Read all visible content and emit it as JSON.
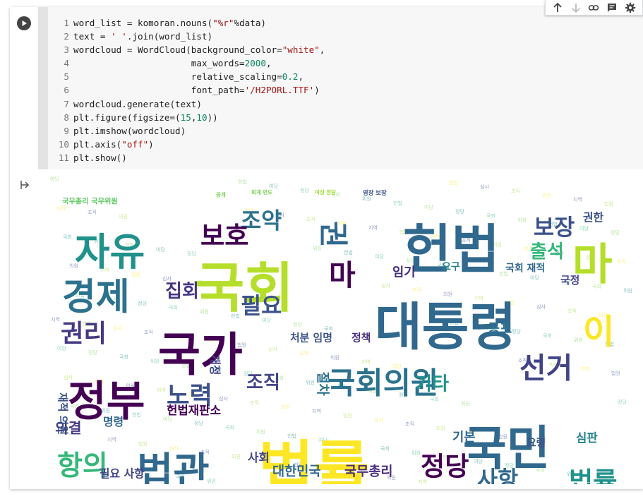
{
  "toolbar": {
    "icons": [
      "arrow-up-icon",
      "arrow-down-icon",
      "link-icon",
      "comment-icon",
      "gear-icon"
    ]
  },
  "code_lines": [
    [
      {
        "t": "word_list = komoran.nouns("
      },
      {
        "t": "\"%r\"",
        "c": "str"
      },
      {
        "t": "%data)"
      }
    ],
    [
      {
        "t": "text = "
      },
      {
        "t": "' '",
        "c": "str"
      },
      {
        "t": ".join(word_list)"
      }
    ],
    [
      {
        "t": "wordcloud = WordCloud(background_color="
      },
      {
        "t": "\"white\"",
        "c": "str"
      },
      {
        "t": ","
      }
    ],
    [
      {
        "t": "                      max_words="
      },
      {
        "t": "2000",
        "c": "num"
      },
      {
        "t": ","
      }
    ],
    [
      {
        "t": "                      relative_scaling="
      },
      {
        "t": "0.2",
        "c": "num"
      },
      {
        "t": ","
      }
    ],
    [
      {
        "t": "                      font_path="
      },
      {
        "t": "'/H2PORL.TTF'",
        "c": "str"
      },
      {
        "t": ")"
      }
    ],
    [
      {
        "t": "wordcloud.generate(text)"
      }
    ],
    [
      {
        "t": "plt.figure(figsize=("
      },
      {
        "t": "15",
        "c": "num"
      },
      {
        "t": ","
      },
      {
        "t": "10",
        "c": "num"
      },
      {
        "t": "))"
      }
    ],
    [
      {
        "t": "plt.imshow(wordcloud)"
      }
    ],
    [
      {
        "t": "plt.axis("
      },
      {
        "t": "\"off\"",
        "c": "str"
      },
      {
        "t": ")"
      }
    ],
    [
      {
        "t": "plt.show()"
      }
    ]
  ],
  "wordcloud": {
    "words": [
      {
        "text": "국무총리 국무위원",
        "size": 11,
        "color": "#5ec962"
      },
      {
        "text": "공개",
        "size": 8,
        "color": "#7ad151"
      },
      {
        "text": "회계 연도",
        "size": 8,
        "color": "#7ad151"
      },
      {
        "text": "여성 정당",
        "size": 8,
        "color": "#a0da39"
      },
      {
        "text": "영장 보장",
        "size": 9,
        "color": "#3b528b"
      },
      {
        "text": "조약",
        "size": 34,
        "color": "#2c728e"
      },
      {
        "text": "보호",
        "size": 40,
        "color": "#440154"
      },
      {
        "text": "자유",
        "size": 58,
        "color": "#21918c"
      },
      {
        "text": "권",
        "size": 44,
        "color": "#31688e"
      },
      {
        "text": "헌법",
        "size": 80,
        "color": "#31688e"
      },
      {
        "text": "보장",
        "size": 34,
        "color": "#3b528b"
      },
      {
        "text": "권한",
        "size": 17,
        "color": "#3b528b"
      },
      {
        "text": "국회",
        "size": 82,
        "color": "#b5de2b"
      },
      {
        "text": "마",
        "size": 66,
        "color": "#b5de2b"
      },
      {
        "text": "마",
        "size": 44,
        "color": "#440154"
      },
      {
        "text": "출석",
        "size": 28,
        "color": "#35b779"
      },
      {
        "text": "경제",
        "size": 56,
        "color": "#2c728e"
      },
      {
        "text": "집회",
        "size": 28,
        "color": "#443983"
      },
      {
        "text": "임기",
        "size": 19,
        "color": "#472d7b"
      },
      {
        "text": "요구",
        "size": 15,
        "color": "#26828e"
      },
      {
        "text": "국회 재적",
        "size": 15,
        "color": "#31688e"
      },
      {
        "text": "대통령",
        "size": 78,
        "color": "#31688e"
      },
      {
        "text": "필요",
        "size": 34,
        "color": "#3b528b"
      },
      {
        "text": "국정",
        "size": 16,
        "color": "#414487"
      },
      {
        "text": "이",
        "size": 52,
        "color": "#fde725"
      },
      {
        "text": "권리",
        "size": 38,
        "color": "#443983"
      },
      {
        "text": "국가",
        "size": 70,
        "color": "#440154"
      },
      {
        "text": "공포",
        "size": 20,
        "color": "#2c728e"
      },
      {
        "text": "처분 임명",
        "size": 16,
        "color": "#3b528b"
      },
      {
        "text": "정책",
        "size": 16,
        "color": "#472d7b"
      },
      {
        "text": "국회의원",
        "size": 46,
        "color": "#2c728e"
      },
      {
        "text": "선거",
        "size": 44,
        "color": "#414487"
      },
      {
        "text": "정부",
        "size": 64,
        "color": "#440154"
      },
      {
        "text": "노력",
        "size": 38,
        "color": "#3b528b"
      },
      {
        "text": "조직",
        "size": 28,
        "color": "#414487"
      },
      {
        "text": "개정",
        "size": 17,
        "color": "#414487"
      },
      {
        "text": "기타",
        "size": 28,
        "color": "#21918c"
      },
      {
        "text": "절차",
        "size": 20,
        "color": "#2c728e"
      },
      {
        "text": "법률",
        "size": 92,
        "color": "#fde725"
      },
      {
        "text": "국민",
        "size": 72,
        "color": "#31688e"
      },
      {
        "text": "헌법재판소",
        "size": 18,
        "color": "#440154"
      },
      {
        "text": "의결",
        "size": 22,
        "color": "#443983"
      },
      {
        "text": "명령",
        "size": 17,
        "color": "#31688e"
      },
      {
        "text": "기본",
        "size": 19,
        "color": "#31688e"
      },
      {
        "text": "심판",
        "size": 18,
        "color": "#26828e"
      },
      {
        "text": "항의",
        "size": 42,
        "color": "#35b779"
      },
      {
        "text": "법관",
        "size": 60,
        "color": "#31688e"
      },
      {
        "text": "정당",
        "size": 40,
        "color": "#440154"
      },
      {
        "text": "요령",
        "size": 16,
        "color": "#3b528b"
      },
      {
        "text": "사회",
        "size": 18,
        "color": "#414487"
      },
      {
        "text": "사항",
        "size": 34,
        "color": "#31688e"
      },
      {
        "text": "법률",
        "size": 40,
        "color": "#21918c"
      },
      {
        "text": "필요 사항",
        "size": 17,
        "color": "#414487"
      },
      {
        "text": "대한민국",
        "size": 20,
        "color": "#31688e"
      },
      {
        "text": "국무총리",
        "size": 20,
        "color": "#472d7b"
      },
      {
        "text": "재적 의원",
        "size": 16,
        "color": "#3b528b"
      }
    ]
  }
}
